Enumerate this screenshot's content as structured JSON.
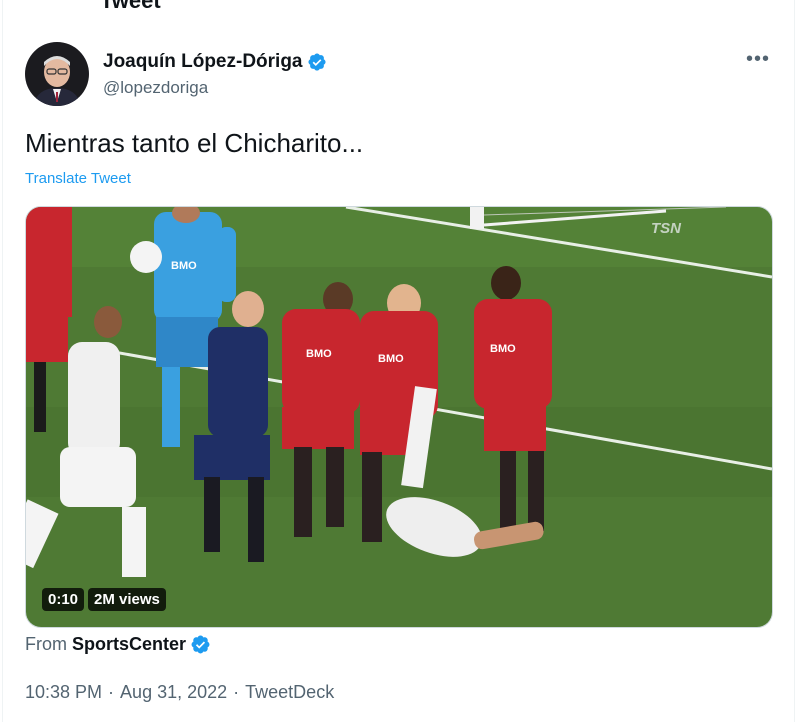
{
  "header": {
    "title_fragment": "Tweet"
  },
  "author": {
    "name": "Joaquín López-Dóriga",
    "handle": "@lopezdoriga"
  },
  "tweet": {
    "text": "Mientras tanto el Chicharito...",
    "translate_label": "Translate Tweet"
  },
  "video": {
    "duration": "0:10",
    "views": "2M views",
    "broadcaster_logo": "TSN",
    "sponsor_text": "BMO"
  },
  "source": {
    "prefix": "From",
    "name": "SportsCenter"
  },
  "meta": {
    "time": "10:38 PM",
    "date": "Aug 31, 2022",
    "client": "TweetDeck",
    "separator": "·"
  },
  "icons": {
    "verified": "verified-badge-icon",
    "more": "more-dots-icon"
  },
  "colors": {
    "accent": "#1d9bf0",
    "text": "#0f1419",
    "secondary": "#536471",
    "pitch": "#4f7a34",
    "toronto_red": "#c8262e",
    "keeper_blue": "#3aa0e0",
    "referee_navy": "#1f2f66"
  }
}
